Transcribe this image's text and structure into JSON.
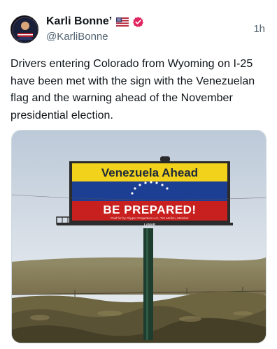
{
  "post": {
    "author_name": "Karli Bonne’",
    "handle": "@KarliBonne",
    "timestamp": "1h",
    "text": "Drivers entering Colorado from Wyoming on I-25 have been met with the sign with the Venezuelan flag and the warning ahead of the November presidential election."
  },
  "badges": {
    "flag": "us-flag-icon",
    "verified": "verified-badge-icon",
    "verified_color": "#e0245e"
  },
  "billboard": {
    "headline": "Venezuela Ahead",
    "warning": "BE PREPARED!",
    "fine_print": "Paid for by Clipper Properties LLC, Tim Mellon, Member",
    "vendor": "LAMAR",
    "flag_colors": [
      "#f2d21b",
      "#1c3f94",
      "#c8201f"
    ]
  }
}
